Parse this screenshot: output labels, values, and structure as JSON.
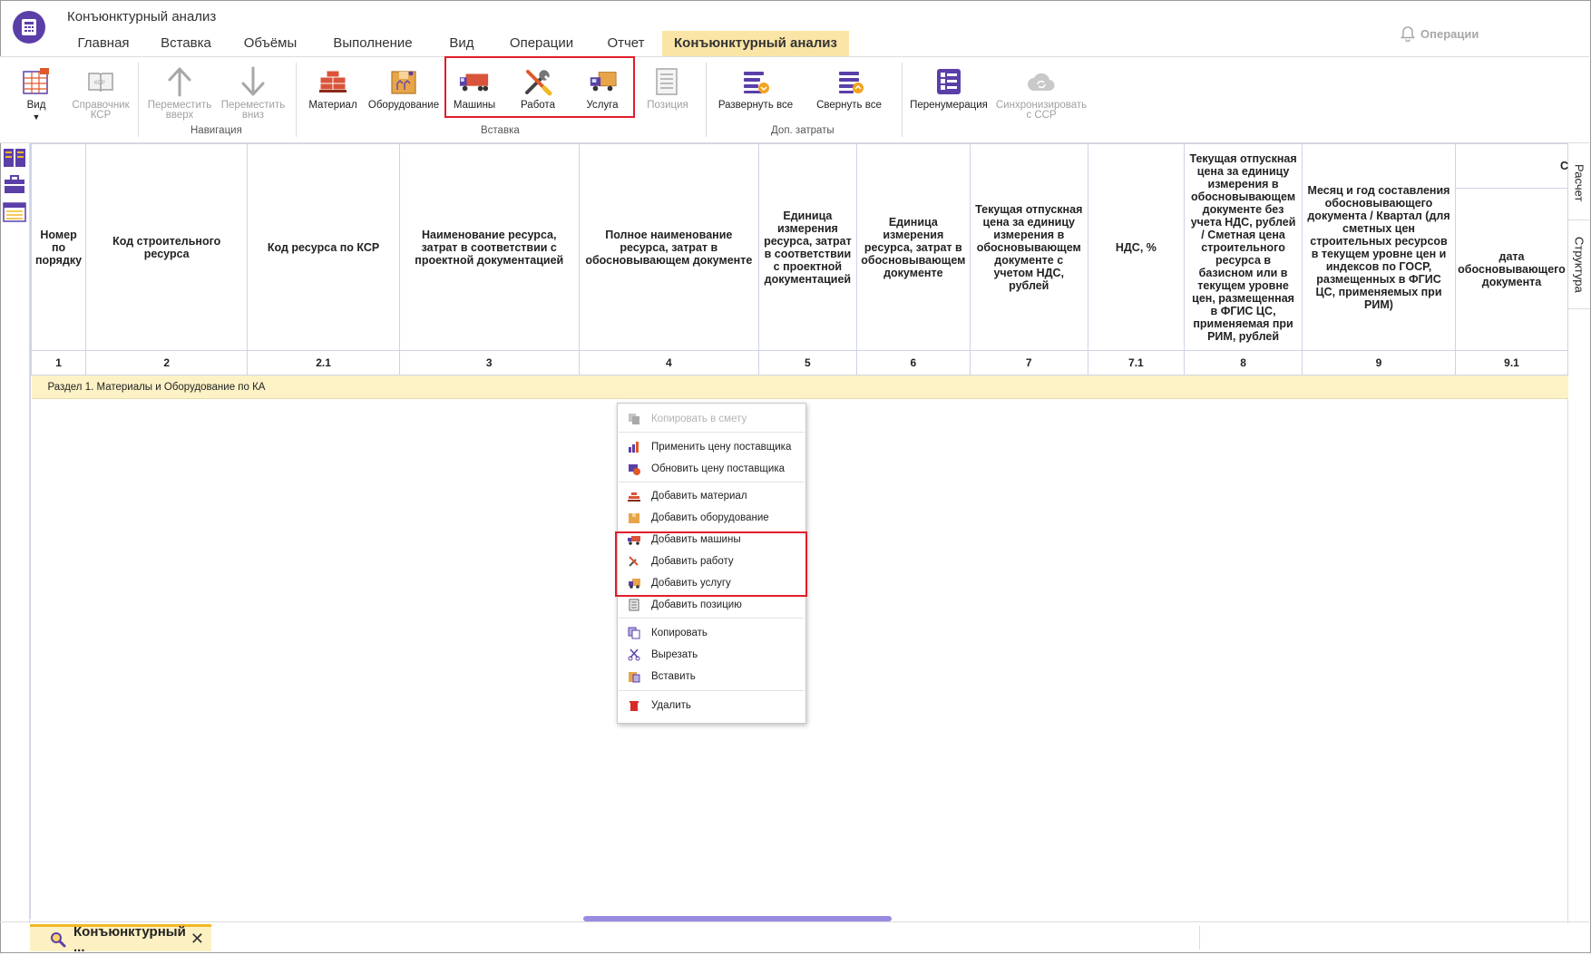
{
  "app": {
    "title": "Конъюнктурный анализ"
  },
  "tabs": [
    {
      "label": "Главная"
    },
    {
      "label": "Вставка"
    },
    {
      "label": "Объёмы"
    },
    {
      "label": "Выполнение"
    },
    {
      "label": "Вид"
    },
    {
      "label": "Операции"
    },
    {
      "label": "Отчет"
    },
    {
      "label": "Конъюнктурный анализ",
      "active": true
    }
  ],
  "header_right": {
    "operations_label": "Операции"
  },
  "ribbon": {
    "buttons": {
      "view": "Вид",
      "ksr_ref": "Справочник КСР",
      "move_up": "Переместить вверх",
      "move_down": "Переместить вниз",
      "material": "Материал",
      "equipment": "Оборудование",
      "machines": "Машины",
      "work": "Работа",
      "service": "Услуга",
      "position": "Позиция",
      "expand_all": "Развернуть все",
      "collapse_all": "Свернуть все",
      "renumber": "Перенумерация",
      "sync": "Синхронизировать с ССР"
    },
    "groups": {
      "navigation": "Навигация",
      "insert": "Вставка",
      "extra_costs": "Доп. затраты"
    }
  },
  "side_tabs": [
    "Расчет",
    "Структура"
  ],
  "table": {
    "headers": [
      "Номер по порядку",
      "Код строительного ресурса",
      "Код ресурса по КСР",
      "Наименование ресурса, затрат в соответствии с проектной документацией",
      "Полное наименование ресурса, затрат в обосновывающем документе",
      "Единица измерения ресурса, затрат в соответствии с проектной документацией",
      "Единица измерения ресурса, затрат в обосновывающем документе",
      "Текущая отпускная цена за единицу измерения в обосновывающем документе с учетом НДС, рублей",
      "НДС, %",
      "Текущая отпускная цена за единицу измерения в обосновывающем документе без учета НДС, рублей / Сметная цена строительного ресурса в базисном или в текущем уровне цен, размещенная в ФГИС ЦС, применяемая при РИМ, рублей",
      "Месяц и год составления обосновывающего документа / Квартал (для сметных цен строительных ресурсов в текущем уровне цен и индексов по ГОСР, размещенных в ФГИС ЦС, применяемых при РИМ)",
      "дата обосновывающего документа"
    ],
    "top_right_cut": "С",
    "column_numbers": [
      "1",
      "2",
      "2.1",
      "3",
      "4",
      "5",
      "6",
      "7",
      "7.1",
      "8",
      "9",
      "9.1"
    ],
    "section_row": "Раздел 1. Материалы и Оборудование по КА"
  },
  "context_menu": {
    "items": [
      {
        "label": "Копировать в смету",
        "icon": "copy-to-estimate-icon",
        "disabled": true
      },
      {
        "label": "Применить цену поставщика",
        "icon": "apply-price-icon"
      },
      {
        "label": "Обновить цену поставщика",
        "icon": "update-price-icon"
      },
      {
        "label": "Добавить материал",
        "icon": "brick-icon"
      },
      {
        "label": "Добавить оборудование",
        "icon": "box-icon"
      },
      {
        "label": "Добавить машины",
        "icon": "truck-icon"
      },
      {
        "label": "Добавить работу",
        "icon": "tools-icon"
      },
      {
        "label": "Добавить услугу",
        "icon": "delivery-icon"
      },
      {
        "label": "Добавить позицию",
        "icon": "position-icon"
      },
      {
        "label": "Копировать",
        "icon": "copy-icon"
      },
      {
        "label": "Вырезать",
        "icon": "scissors-icon"
      },
      {
        "label": "Вставить",
        "icon": "paste-icon"
      },
      {
        "label": "Удалить",
        "icon": "trash-icon"
      }
    ]
  },
  "bottom": {
    "doc_tab_label": "Конъюнктурный ...",
    "close_symbol": "✕"
  },
  "colors": {
    "accent": "#5b3fa8",
    "active_tab": "#fbe5a6",
    "section_row": "#fdf2c6",
    "highlight": "#e11d2a"
  }
}
